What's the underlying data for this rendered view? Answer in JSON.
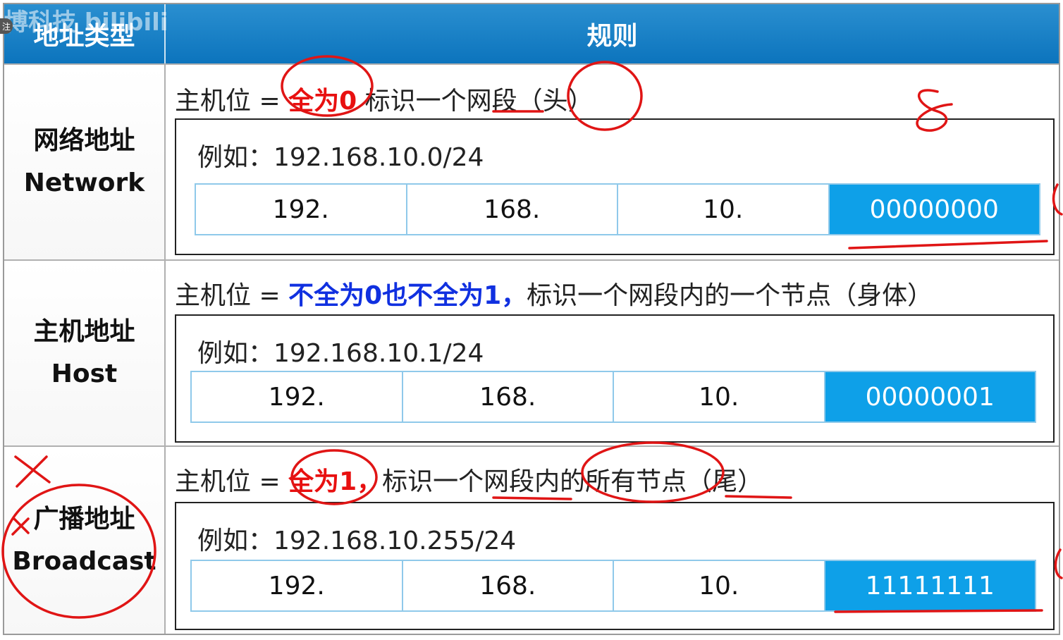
{
  "header": {
    "type_label": "地址类型",
    "rule_label": "规则"
  },
  "watermark": {
    "text": "博科技 bilibili",
    "tag": "注"
  },
  "rows": [
    {
      "type_cn": "网络地址",
      "type_en": "Network",
      "rule_prefix": "主机位 = ",
      "rule_highlight": "全为0",
      "rule_suffix": "  标识一个网段（头）",
      "example": "例如：192.168.10.0/24",
      "octets": [
        "192.",
        "168.",
        "10.",
        "00000000"
      ]
    },
    {
      "type_cn": "主机地址",
      "type_en": "Host",
      "rule_prefix": "主机位 = ",
      "rule_highlight": "不全为0也不全为1，",
      "rule_suffix": "标识一个网段内的一个节点（身体）",
      "example": "例如：192.168.10.1/24",
      "octets": [
        "192.",
        "168.",
        "10.",
        "00000001"
      ]
    },
    {
      "type_cn": "广播地址",
      "type_en": "Broadcast",
      "rule_prefix": "主机位 = ",
      "rule_highlight": "全为1，",
      "rule_suffix": "标识一个网段内的所有节点（尾）",
      "example": "例如：192.168.10.255/24",
      "octets": [
        "192.",
        "168.",
        "10.",
        "11111111"
      ]
    }
  ],
  "colors": {
    "header": "#0c74bd",
    "octet_highlight": "#0ea0e8",
    "red_emphasis": "#e81010",
    "blue_emphasis": "#1030e0",
    "annotation_ink": "#e01515"
  }
}
